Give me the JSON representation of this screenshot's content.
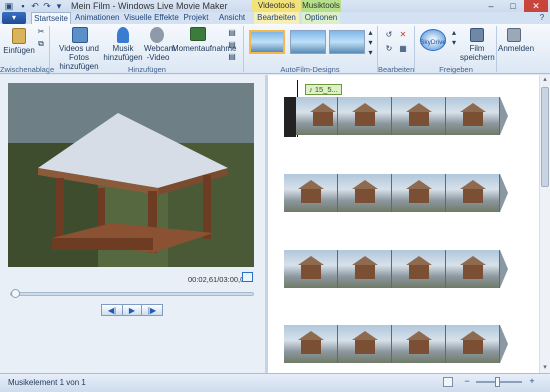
{
  "window": {
    "title": "Mein Film - Windows Live Movie Maker",
    "context_tab_video": "Videotools",
    "context_tab_music": "Musiktools",
    "minimize": "–",
    "maximize": "□",
    "close": "✕"
  },
  "quick_access": {
    "save_icon": "save-icon",
    "undo_icon": "undo-icon",
    "redo_icon": "redo-icon"
  },
  "tabs": [
    {
      "label": "Startseite",
      "active": true
    },
    {
      "label": "Animationen"
    },
    {
      "label": "Visuelle Effekte"
    },
    {
      "label": "Projekt"
    },
    {
      "label": "Ansicht"
    },
    {
      "label": "Bearbeiten"
    },
    {
      "label": "Optionen"
    }
  ],
  "ribbon": {
    "clipboard": {
      "paste": "Einfügen",
      "group": "Zwischenablage"
    },
    "add": {
      "videos_photos": "Videos und Fotos hinzufügen",
      "music": "Musik hinzufügen",
      "webcam": "Webcam -Video",
      "snapshot": "Momentaufnahme",
      "group": "Hinzufügen"
    },
    "autofilm": {
      "group": "AutoFilm-Designs"
    },
    "edit": {
      "group": "Bearbeiten"
    },
    "share": {
      "skydrive": "SkyDrive",
      "save_movie": "Film speichern",
      "signin": "Anmelden",
      "group": "Freigeben"
    }
  },
  "preview": {
    "time": "00:02,61/03:00,00",
    "prev_frame": "◀|",
    "play": "▶",
    "next_frame": "|▶"
  },
  "storyboard": {
    "clip_label": "15_5..."
  },
  "status": {
    "text": "Musikelement 1 von 1",
    "zoom_minus": "−",
    "zoom_plus": "+"
  },
  "colors": {
    "accent": "#1f5bb0",
    "context_video": "#f2e27a",
    "context_music": "#b6e08a"
  }
}
